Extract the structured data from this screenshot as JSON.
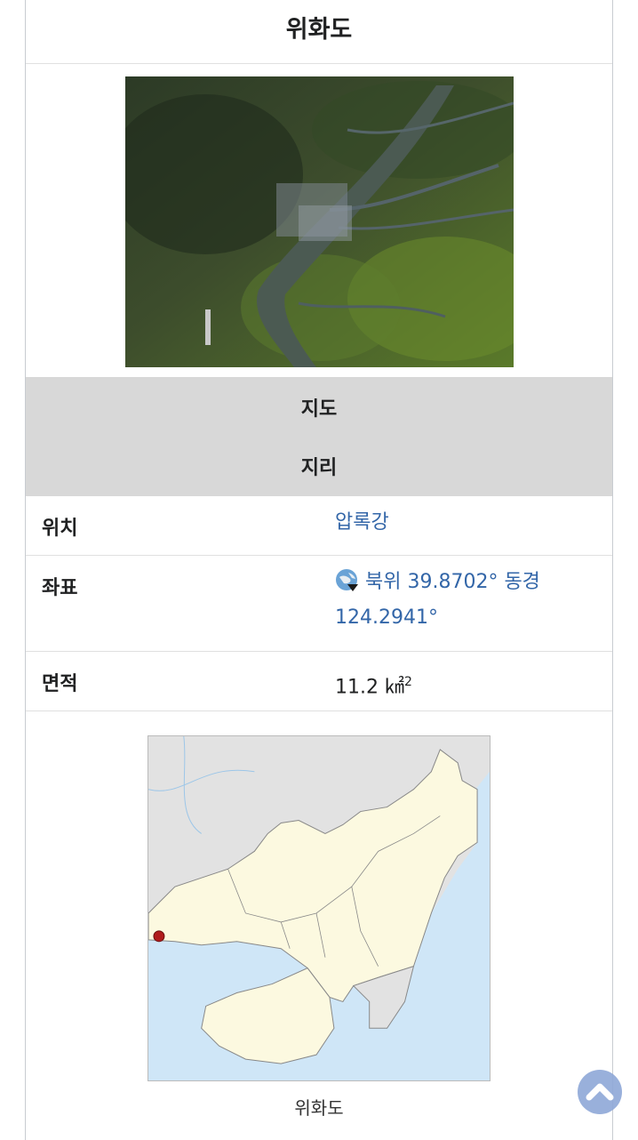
{
  "title": "위화도",
  "sections": {
    "map_header": "지도",
    "geo_header": "지리"
  },
  "fields": {
    "location_label": "위치",
    "location_value": "압록강",
    "coord_label": "좌표",
    "coord_value": "북위 39.8702° 동경 124.2941°",
    "area_label": "면적",
    "area_value": "11.2 ㎢",
    "area_sup": "2"
  },
  "map_caption": "위화도",
  "icons": {
    "coordinates": "globe-icon",
    "scroll_top": "chevron-up-icon"
  },
  "colors": {
    "link": "#3366a8",
    "section_bg": "#d8d8d8",
    "sea": "#cfe6f7",
    "land": "#fcf9e0",
    "marker": "#b01c1c",
    "scroll_button": "#8fa8d8"
  }
}
